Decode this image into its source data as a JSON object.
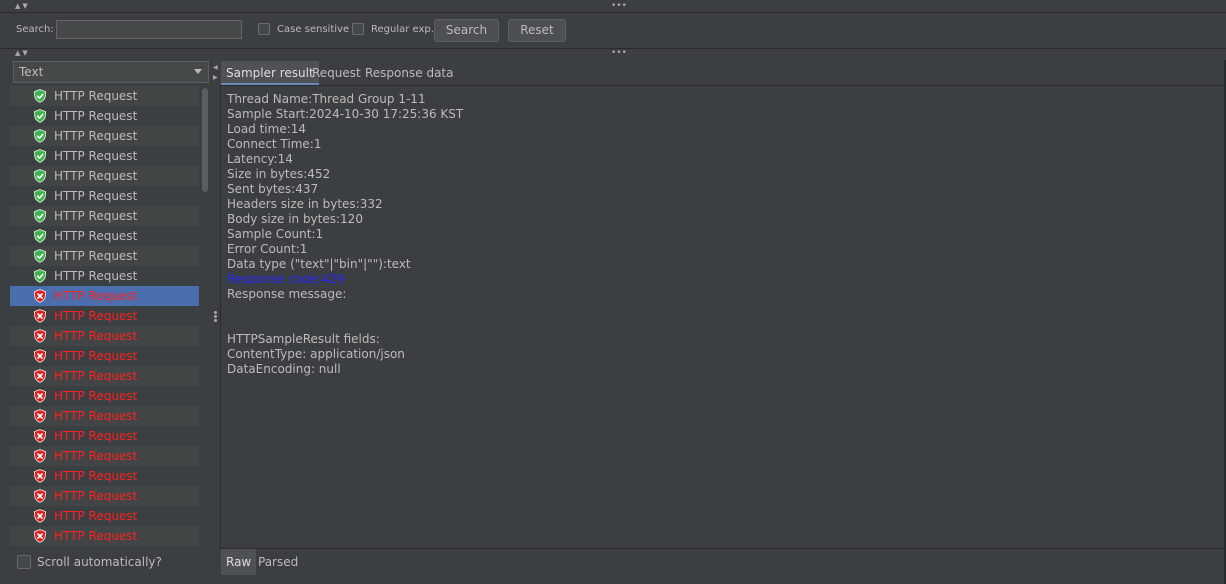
{
  "search": {
    "label": "Search:",
    "value": "",
    "case_sensitive_label": "Case sensitive",
    "regex_label": "Regular exp.",
    "search_button": "Search",
    "reset_button": "Reset"
  },
  "left": {
    "renderer_selected": "Text",
    "scroll_auto_label": "Scroll automatically?",
    "items": [
      {
        "label": "HTTP Request",
        "status": "success"
      },
      {
        "label": "HTTP Request",
        "status": "success"
      },
      {
        "label": "HTTP Request",
        "status": "success"
      },
      {
        "label": "HTTP Request",
        "status": "success"
      },
      {
        "label": "HTTP Request",
        "status": "success"
      },
      {
        "label": "HTTP Request",
        "status": "success"
      },
      {
        "label": "HTTP Request",
        "status": "success"
      },
      {
        "label": "HTTP Request",
        "status": "success"
      },
      {
        "label": "HTTP Request",
        "status": "success"
      },
      {
        "label": "HTTP Request",
        "status": "success"
      },
      {
        "label": "HTTP Request",
        "status": "error",
        "selected": true
      },
      {
        "label": "HTTP Request",
        "status": "error"
      },
      {
        "label": "HTTP Request",
        "status": "error"
      },
      {
        "label": "HTTP Request",
        "status": "error"
      },
      {
        "label": "HTTP Request",
        "status": "error"
      },
      {
        "label": "HTTP Request",
        "status": "error"
      },
      {
        "label": "HTTP Request",
        "status": "error"
      },
      {
        "label": "HTTP Request",
        "status": "error"
      },
      {
        "label": "HTTP Request",
        "status": "error"
      },
      {
        "label": "HTTP Request",
        "status": "error"
      },
      {
        "label": "HTTP Request",
        "status": "error"
      },
      {
        "label": "HTTP Request",
        "status": "error"
      },
      {
        "label": "HTTP Request",
        "status": "error"
      }
    ]
  },
  "tabs": [
    "Sampler result",
    "Request",
    "Response data"
  ],
  "sampler_result": {
    "lines": [
      {
        "text": "Thread Name:Thread Group 1-11"
      },
      {
        "text": "Sample Start:2024-10-30 17:25:36 KST"
      },
      {
        "text": "Load time:14"
      },
      {
        "text": "Connect Time:1"
      },
      {
        "text": "Latency:14"
      },
      {
        "text": "Size in bytes:452"
      },
      {
        "text": "Sent bytes:437"
      },
      {
        "text": "Headers size in bytes:332"
      },
      {
        "text": "Body size in bytes:120"
      },
      {
        "text": "Sample Count:1"
      },
      {
        "text": "Error Count:1"
      },
      {
        "text": "Data type (\"text\"|\"bin\"|\"\"):text"
      },
      {
        "text": "Response code:429",
        "style": "link"
      },
      {
        "text": "Response message: "
      },
      {
        "text": ""
      },
      {
        "text": ""
      },
      {
        "text": "HTTPSampleResult fields:"
      },
      {
        "text": "ContentType: application/json"
      },
      {
        "text": "DataEncoding: null"
      }
    ]
  },
  "bottom_tabs": [
    "Raw",
    "Parsed"
  ],
  "colors": {
    "background": "#3c3f41",
    "selected_row": "#4b6eaf",
    "error_text": "#ff2020",
    "success_icon": "#3bb54a",
    "error_icon": "#e02020",
    "link_text": "#2323ff"
  },
  "icons": {
    "success": "shield-check-icon",
    "error": "shield-x-icon"
  }
}
